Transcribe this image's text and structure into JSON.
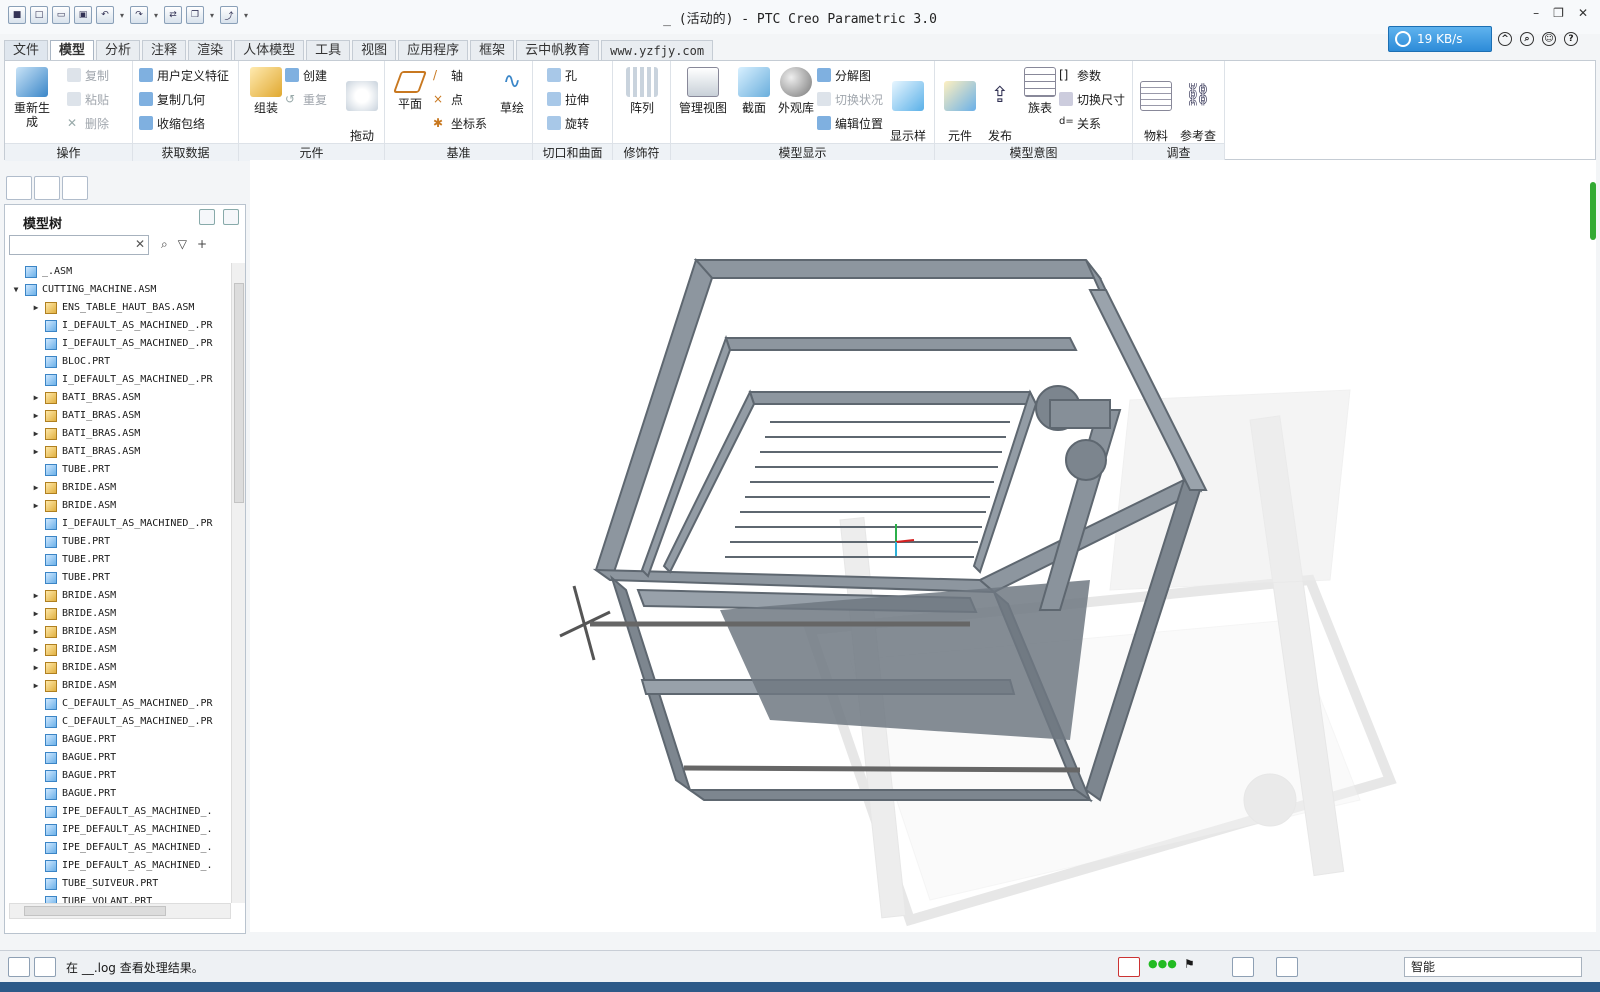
{
  "window": {
    "title": "_ (活动的) - PTC Creo Parametric 3.0",
    "network_speed": "19 KB/s"
  },
  "tabs": [
    "文件",
    "模型",
    "分析",
    "注释",
    "渲染",
    "人体模型",
    "工具",
    "视图",
    "应用程序",
    "框架",
    "云中帆教育",
    "www.yzfjy.com"
  ],
  "ribbon": {
    "operations": {
      "regenerate": "重新生成",
      "copy": "复制",
      "paste": "粘贴",
      "delete": "删除",
      "group": "操作"
    },
    "get_data": {
      "udf": "用户定义特征",
      "copy_geom": "复制几何",
      "shrinkwrap": "收缩包络",
      "group": "获取数据"
    },
    "component": {
      "assemble": "组装",
      "create": "创建",
      "repeat": "重复",
      "drag": "拖动\n元件",
      "group": "元件"
    },
    "datum": {
      "plane": "平面",
      "axis": "轴",
      "point": "点",
      "csys": "坐标系",
      "sketch": "草绘",
      "group": "基准"
    },
    "cut_surface": {
      "hole": "孔",
      "extrude": "拉伸",
      "revolve": "旋转",
      "group": "切口和曲面"
    },
    "modifiers": {
      "pattern": "阵列",
      "group": "修饰符"
    },
    "model_display": {
      "manage_views": "管理视图",
      "section": "截面",
      "appearance": "外观库",
      "exploded": "分解图",
      "toggle_state": "切换状况",
      "edit_position": "编辑位置",
      "display_style": "显示样\n式",
      "group": "模型显示"
    },
    "model_intent": {
      "comp_interface": "元件\n界面",
      "publish_geom": "发布\n几何",
      "family_table": "族表",
      "params": "参数",
      "switch_dims": "切换尺寸",
      "relations": "关系",
      "group": "模型意图"
    },
    "investigate": {
      "bom": "物料\n清单",
      "ref_viewer": "参考查\n看器",
      "group": "调查"
    }
  },
  "model_tree": {
    "title": "模型树",
    "items": [
      {
        "name": "_.ASM",
        "level": 0,
        "expand": "",
        "kind": "asm"
      },
      {
        "name": "CUTTING_MACHINE.ASM",
        "level": 1,
        "expand": "▼",
        "kind": "asm"
      },
      {
        "name": "ENS_TABLE_HAUT_BAS.ASM",
        "level": 2,
        "expand": "▶",
        "kind": "asm"
      },
      {
        "name": "I_DEFAULT_AS_MACHINED_.PR",
        "level": 2,
        "expand": "",
        "kind": "prt"
      },
      {
        "name": "I_DEFAULT_AS_MACHINED_.PR",
        "level": 2,
        "expand": "",
        "kind": "prt"
      },
      {
        "name": "BLOC.PRT",
        "level": 2,
        "expand": "",
        "kind": "prt"
      },
      {
        "name": "I_DEFAULT_AS_MACHINED_.PR",
        "level": 2,
        "expand": "",
        "kind": "prt"
      },
      {
        "name": "BATI_BRAS.ASM",
        "level": 2,
        "expand": "▶",
        "kind": "asm"
      },
      {
        "name": "BATI_BRAS.ASM",
        "level": 2,
        "expand": "▶",
        "kind": "asm"
      },
      {
        "name": "BATI_BRAS.ASM",
        "level": 2,
        "expand": "▶",
        "kind": "asm"
      },
      {
        "name": "BATI_BRAS.ASM",
        "level": 2,
        "expand": "▶",
        "kind": "asm"
      },
      {
        "name": "TUBE.PRT",
        "level": 2,
        "expand": "",
        "kind": "prt"
      },
      {
        "name": "BRIDE.ASM",
        "level": 2,
        "expand": "▶",
        "kind": "asm"
      },
      {
        "name": "BRIDE.ASM",
        "level": 2,
        "expand": "▶",
        "kind": "asm"
      },
      {
        "name": "I_DEFAULT_AS_MACHINED_.PR",
        "level": 2,
        "expand": "",
        "kind": "prt"
      },
      {
        "name": "TUBE.PRT",
        "level": 2,
        "expand": "",
        "kind": "prt"
      },
      {
        "name": "TUBE.PRT",
        "level": 2,
        "expand": "",
        "kind": "prt"
      },
      {
        "name": "TUBE.PRT",
        "level": 2,
        "expand": "",
        "kind": "prt"
      },
      {
        "name": "BRIDE.ASM",
        "level": 2,
        "expand": "▶",
        "kind": "asm"
      },
      {
        "name": "BRIDE.ASM",
        "level": 2,
        "expand": "▶",
        "kind": "asm"
      },
      {
        "name": "BRIDE.ASM",
        "level": 2,
        "expand": "▶",
        "kind": "asm"
      },
      {
        "name": "BRIDE.ASM",
        "level": 2,
        "expand": "▶",
        "kind": "asm"
      },
      {
        "name": "BRIDE.ASM",
        "level": 2,
        "expand": "▶",
        "kind": "asm"
      },
      {
        "name": "BRIDE.ASM",
        "level": 2,
        "expand": "▶",
        "kind": "asm"
      },
      {
        "name": "C_DEFAULT_AS_MACHINED_.PR",
        "level": 2,
        "expand": "",
        "kind": "prt"
      },
      {
        "name": "C_DEFAULT_AS_MACHINED_.PR",
        "level": 2,
        "expand": "",
        "kind": "prt"
      },
      {
        "name": "BAGUE.PRT",
        "level": 2,
        "expand": "",
        "kind": "prt"
      },
      {
        "name": "BAGUE.PRT",
        "level": 2,
        "expand": "",
        "kind": "prt"
      },
      {
        "name": "BAGUE.PRT",
        "level": 2,
        "expand": "",
        "kind": "prt"
      },
      {
        "name": "BAGUE.PRT",
        "level": 2,
        "expand": "",
        "kind": "prt"
      },
      {
        "name": "IPE_DEFAULT_AS_MACHINED_.",
        "level": 2,
        "expand": "",
        "kind": "prt"
      },
      {
        "name": "IPE_DEFAULT_AS_MACHINED_.",
        "level": 2,
        "expand": "",
        "kind": "prt"
      },
      {
        "name": "IPE_DEFAULT_AS_MACHINED_.",
        "level": 2,
        "expand": "",
        "kind": "prt"
      },
      {
        "name": "IPE_DEFAULT_AS_MACHINED_.",
        "level": 2,
        "expand": "",
        "kind": "prt"
      },
      {
        "name": "TUBE_SUIVEUR.PRT",
        "level": 2,
        "expand": "",
        "kind": "prt"
      },
      {
        "name": "TUBE_VOLANT.PRT",
        "level": 2,
        "expand": "",
        "kind": "prt"
      }
    ]
  },
  "status": {
    "message": "在 __.log 查看处理结果。",
    "selection_filter": "智能"
  },
  "colors": {
    "accent": "#2d8bd8",
    "model_grey": "#8a939c"
  }
}
